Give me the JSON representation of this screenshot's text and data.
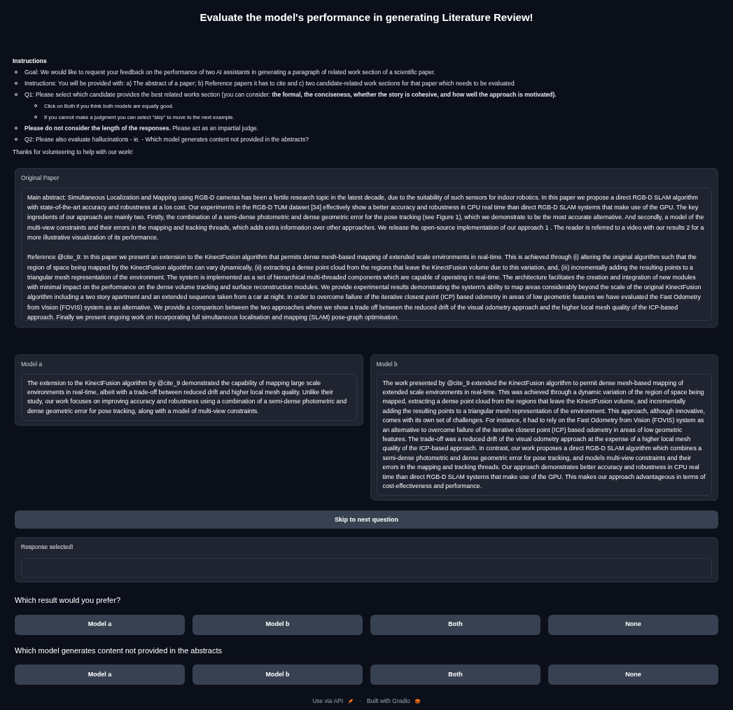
{
  "title": "Evaluate the model's performance in generating Literature Review!",
  "instructions": {
    "heading": "Instructions",
    "items": [
      {
        "text": "Goal: We would like to request your feedback on the performance of two AI assistants in generating a paragraph of related work section of a scientific paper."
      },
      {
        "text": "Instructions: You will be provided with: a) The abstract of a paper; b) Reference papers it has to cite and c) two candidate-related work sections for that paper which needs to be evaluated"
      },
      {
        "text": "Q1: Please select which candidate provides the best related works section (you can consider: **the formal, the conciseness, whether the story is cohesive, and how well the approach is motivated).**",
        "children": [
          {
            "text": "Click on Both if you think both models are equally good."
          },
          {
            "text": "If you cannot make a judgment you can select \"skip\" to move to the next example."
          }
        ]
      },
      {
        "text": "**Please do not consider the length of the responses.** Please act as an impartial judge."
      },
      {
        "text": "Q2: Please also evaluate hallucinations - ie. - Which model generates content not provided in the abstracts?"
      }
    ],
    "closing": "Thanks for volunteering to help with our work!"
  },
  "original_paper": {
    "label": "Original Paper",
    "paragraphs": [
      "Main abstract: Simultaneous Localization and Mapping using RGB-D cameras has been a fertile research topic in the latest decade, due to the suitability of such sensors for indoor robotics. In this paper we propose a direct RGB-D SLAM algorithm with state-of-the-art accuracy and robustness at a los cost. Our experiments in the RGB-D TUM dataset [34] effectively show a better accuracy and robustness in CPU real time than direct RGB-D SLAM systems that make use of the GPU. The key ingredients of our approach are mainly two. Firstly, the combination of a semi-dense photometric and dense geometric error for the pose tracking (see Figure 1), which we demonstrate to be the most accurate alternative. And secondly, a model of the multi-view constraints and their errors in the mapping and tracking threads, which adds extra information over other approaches. We release the open-source implementation of our approach 1 . The reader is referred to a video with our results 2 for a more illustrative visualization of its performance.",
      "Reference @cite_9: In this paper we present an extension to the KinectFusion algorithm that permits dense mesh-based mapping of extended scale environments in real-time. This is achieved through (i) altering the original algorithm such that the region of space being mapped by the KinectFusion algorithm can vary dynamically, (ii) extracting a dense point cloud from the regions that leave the KinectFusion volume due to this variation, and, (iii) incrementally adding the resulting points to a triangular mesh representation of the environment. The system is implemented as a set of hierarchical multi-threaded components which are capable of operating in real-time. The architecture facilitates the creation and integration of new modules with minimal impact on the performance on the dense volume tracking and surface reconstruction modules. We provide experimental results demonstrating the system's ability to map areas considerably beyond the scale of the original KinectFusion algorithm including a two story apartment and an extended sequence taken from a car at night. In order to overcome failure of the iterative closest point (ICP) based odometry in areas of low geometric features we have evaluated the Fast Odometry from Vision (FOVIS) system as an alternative. We provide a comparison between the two approaches where we show a trade off between the reduced drift of the visual odometry approach and the higher local mesh quality of the ICP-based approach. Finally we present ongoing work on incorporating full simultaneous localisation and mapping (SLAM) pose-graph optimisation."
    ]
  },
  "models": [
    {
      "label": "Model a",
      "text": "The extension to the KinectFusion algorithm by @cite_9 demonstrated the capability of mapping large scale environments in real-time, albeit with a trade-off between reduced drift and higher local mesh quality. Unlike their study, our work focuses on improving accuracy and robustness using a combination of a semi-dense photometric and dense geometric error for pose tracking, along with a model of multi-view constraints."
    },
    {
      "label": "Model b",
      "text": "The work presented by @cite_9 extended the KinectFusion algorithm to permit dense mesh-based mapping of extended scale environments in real-time. This was achieved through a dynamic variation of the region of space being mapped, extracting a dense point cloud from the regions that leave the KinectFusion volume, and incrementally adding the resulting points to a triangular mesh representation of the environment. This approach, although innovative, comes with its own set of challenges. For instance, it had to rely on the Fast Odometry from Vision (FOVIS) system as an alternative to overcome failure of the iterative closest point (ICP) based odometry in areas of low geometric features. The trade-off was a reduced drift of the visual odometry approach at the expense of a higher local mesh quality of the ICP-based approach. In contrast, our work proposes a direct RGB-D SLAM algorithm which combines a semi-dense photometric and dense geometric error for pose tracking, and models multi-view constraints and their errors in the mapping and tracking threads. Our approach demonstrates better accuracy and robustness in CPU real time than direct RGB-D SLAM systems that make use of the GPU. This makes our approach advantageous in terms of cost-effectiveness and performance."
    }
  ],
  "skip_button": "Skip to next question",
  "response": {
    "label": "Response selected!"
  },
  "questions": [
    {
      "text": "Which result would you prefer?",
      "options": [
        "Model a",
        "Model b",
        "Both",
        "None"
      ]
    },
    {
      "text": "Which model generates content not provided in the abstracts",
      "options": [
        "Model a",
        "Model b",
        "Both",
        "None"
      ]
    }
  ],
  "footer": {
    "api_link": "Use via API",
    "separator": "·",
    "built_with": "Built with Gradio"
  }
}
